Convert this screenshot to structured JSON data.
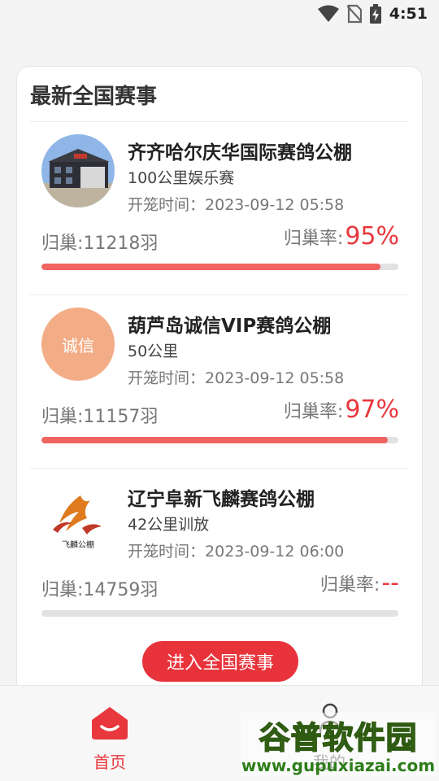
{
  "status_bar": {
    "time": "4:51",
    "icons": [
      "wifi-icon",
      "no-sim-icon",
      "battery-charging-icon"
    ]
  },
  "card": {
    "title": "最新全国赛事",
    "events": [
      {
        "name": "齐齐哈尔庆华国际赛鸽公棚",
        "distance": "100公里娱乐赛",
        "time_label": "开笼时间：",
        "time_value": "2023-09-12 05:58",
        "count_label": "归巢:11218羽",
        "rate_label": "归巢率:",
        "rate_value": "95%",
        "progress": 0.95
      },
      {
        "name": "葫芦岛诚信VIP赛鸽公棚",
        "distance": "50公里",
        "logo_text": "诚信",
        "time_label": "开笼时间：",
        "time_value": "2023-09-12 05:58",
        "count_label": "归巢:11157羽",
        "rate_label": "归巢率:",
        "rate_value": "97%",
        "progress": 0.97
      },
      {
        "name": "辽宁阜新飞麟赛鸽公棚",
        "distance": "42公里训放",
        "logo_text": "飞麟公棚",
        "time_label": "开笼时间：",
        "time_value": "2023-09-12 06:00",
        "count_label": "归巢:14759羽",
        "rate_label": "归巢率:",
        "rate_value": "--",
        "progress": 0
      }
    ],
    "enter_button": "进入全国赛事"
  },
  "tabs": {
    "home": "首页",
    "mine": "我的"
  },
  "watermark": {
    "name": "谷普软件园",
    "url": "www.gupuxiazai.com"
  },
  "colors": {
    "accent": "#e8383d",
    "progress": "#ef6461"
  }
}
